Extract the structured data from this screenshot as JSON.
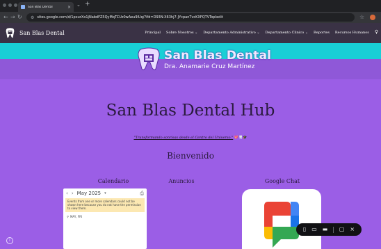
{
  "browser": {
    "tab_title": "San Blas Dental",
    "url": "sites.google.com/d/1pxurXo1jNabdFZ5QyMqTCUz0wAeu9lUq/?ifd=D93N-X63hj7-JYcpanTvcKXFQTVTopIedit",
    "icons": [
      "close-window-icon",
      "tab-close-icon",
      "new-tab-icon",
      "back-icon",
      "forward-icon",
      "reload-icon",
      "site-info-icon",
      "bookmark-star-icon"
    ]
  },
  "site": {
    "name": "San Blas Dental",
    "nav": [
      {
        "label": "Principal"
      },
      {
        "label": "Sobre Nosotros ⌄"
      },
      {
        "label": "Departamento Administrativo ⌄"
      },
      {
        "label": "Departamento Clinico ⌄"
      },
      {
        "label": "Reportes"
      },
      {
        "label": "Recursos Humanos"
      }
    ]
  },
  "banner": {
    "clinic": "San Blas Dental",
    "doctor": "Dra. Anamarie Cruz Martínez"
  },
  "main": {
    "title": "San Blas Dental Hub",
    "tagline": "\"Transformando sonrisas desde el Centro del Universo.\"",
    "tagline_emoji": "💖🦷🎓",
    "welcome": "Bienvenido",
    "columns": {
      "calendar": "Calendario",
      "announcements": "Anuncios",
      "chat": "Google Chat"
    }
  },
  "calendar": {
    "month": "May 2025",
    "dropdown": "▾",
    "warning": "Events from one or more calendars could not be shown here because you do not have the permission to view them.",
    "date": "MAY, FRI"
  },
  "colors": {
    "page_bg": "#9b5ee6",
    "banner": "#19cfd6",
    "header": "#3a3245"
  }
}
